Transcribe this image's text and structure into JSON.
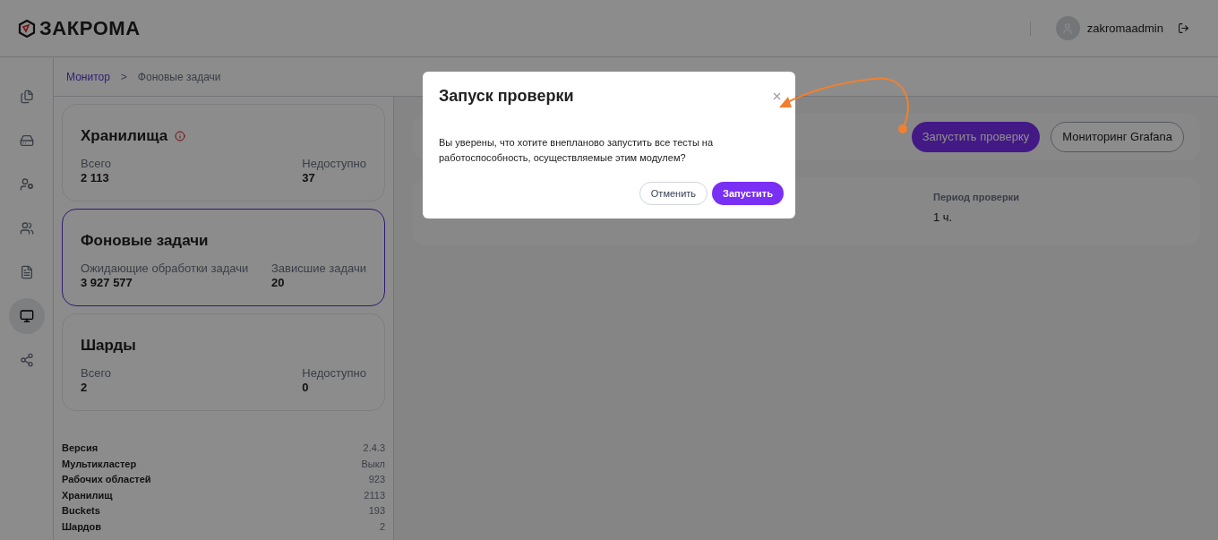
{
  "header": {
    "logo": "ЗАКРОМА",
    "user": "zakromaadmin"
  },
  "sidebar": {
    "items": [
      {
        "selected": false
      },
      {
        "selected": false
      },
      {
        "selected": false
      },
      {
        "selected": false
      },
      {
        "selected": false
      },
      {
        "selected": true
      },
      {
        "selected": false
      }
    ]
  },
  "breadcrumb": [
    {
      "label": "Монитор",
      "kind": "link"
    },
    {
      "label": ">",
      "kind": "separator"
    },
    {
      "label": "Фоновые задачи",
      "kind": "current"
    }
  ],
  "cards": [
    {
      "title": "Хранилища",
      "warning": true,
      "selected": false,
      "stats": [
        {
          "label": "Всего",
          "value": "2 113"
        },
        {
          "label": "Недоступно",
          "value": "37"
        }
      ]
    },
    {
      "title": "Фоновые задачи",
      "warning": false,
      "selected": true,
      "stats": [
        {
          "label": "Ожидающие обработки задачи",
          "value": "3 927 577"
        },
        {
          "label": "Зависшие задачи",
          "value": "20"
        }
      ]
    },
    {
      "title": "Шарды",
      "warning": false,
      "selected": false,
      "stats": [
        {
          "label": "Всего",
          "value": "2"
        },
        {
          "label": "Недоступно",
          "value": "0"
        }
      ]
    }
  ],
  "info": [
    {
      "label": "Версия",
      "value": "2.4.3"
    },
    {
      "label": "Мультикластер",
      "value": "Выкл"
    },
    {
      "label": "Рабочих областей",
      "value": "923"
    },
    {
      "label": "Хранилищ",
      "value": "2113"
    },
    {
      "label": "Buckets",
      "value": "193"
    },
    {
      "label": "Шардов",
      "value": "2"
    }
  ],
  "toolbar": {
    "buttons": [
      {
        "label": "Запустить проверку",
        "kind": "primary"
      },
      {
        "label": "Мониторинг Grafana",
        "kind": "outline"
      }
    ]
  },
  "table": {
    "cells": [
      {
        "heading": "Период проверки",
        "value": "1 ч."
      }
    ]
  },
  "dialog": {
    "title": "Запуск проверки",
    "text": "Вы уверены, что хотите внепланово запустить все тесты на работоспособность, осуществляемые этим модулем?",
    "buttons": [
      {
        "label": "Отменить",
        "kind": "secondary"
      },
      {
        "label": "Запустить",
        "kind": "primary"
      }
    ]
  }
}
